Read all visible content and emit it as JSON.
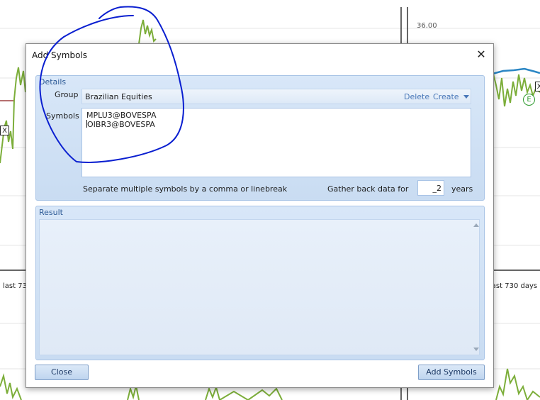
{
  "background": {
    "price_label": "36.00",
    "range_left_label": "last 730",
    "range_right_label": "last 730 days",
    "marker_x": "X",
    "marker_e": "E"
  },
  "dialog": {
    "title": "Add Symbols",
    "close_glyph": "✕",
    "details": {
      "caption": "Details",
      "group_label": "Group",
      "group_value": "Brazilian Equities",
      "delete_label": "Delete",
      "create_label": "Create",
      "symbols_label": "Symbols",
      "symbols_lines": [
        "MPLU3@BOVESPA",
        "OIBR3@BOVESPA"
      ],
      "hint": "Separate multiple symbols by a comma or linebreak",
      "gather_label": "Gather back data for",
      "years_value": "_2",
      "years_suffix": "years"
    },
    "result": {
      "caption": "Result",
      "text": ""
    },
    "buttons": {
      "close_label": "Close",
      "add_label": "Add Symbols"
    }
  },
  "colors": {
    "accent": "#4a78b8",
    "panel": "#d8e7f8",
    "annotation_ink": "#0a1fd0",
    "chart_line": "#7cae3a",
    "chart_line_blue": "#2b86c4"
  }
}
